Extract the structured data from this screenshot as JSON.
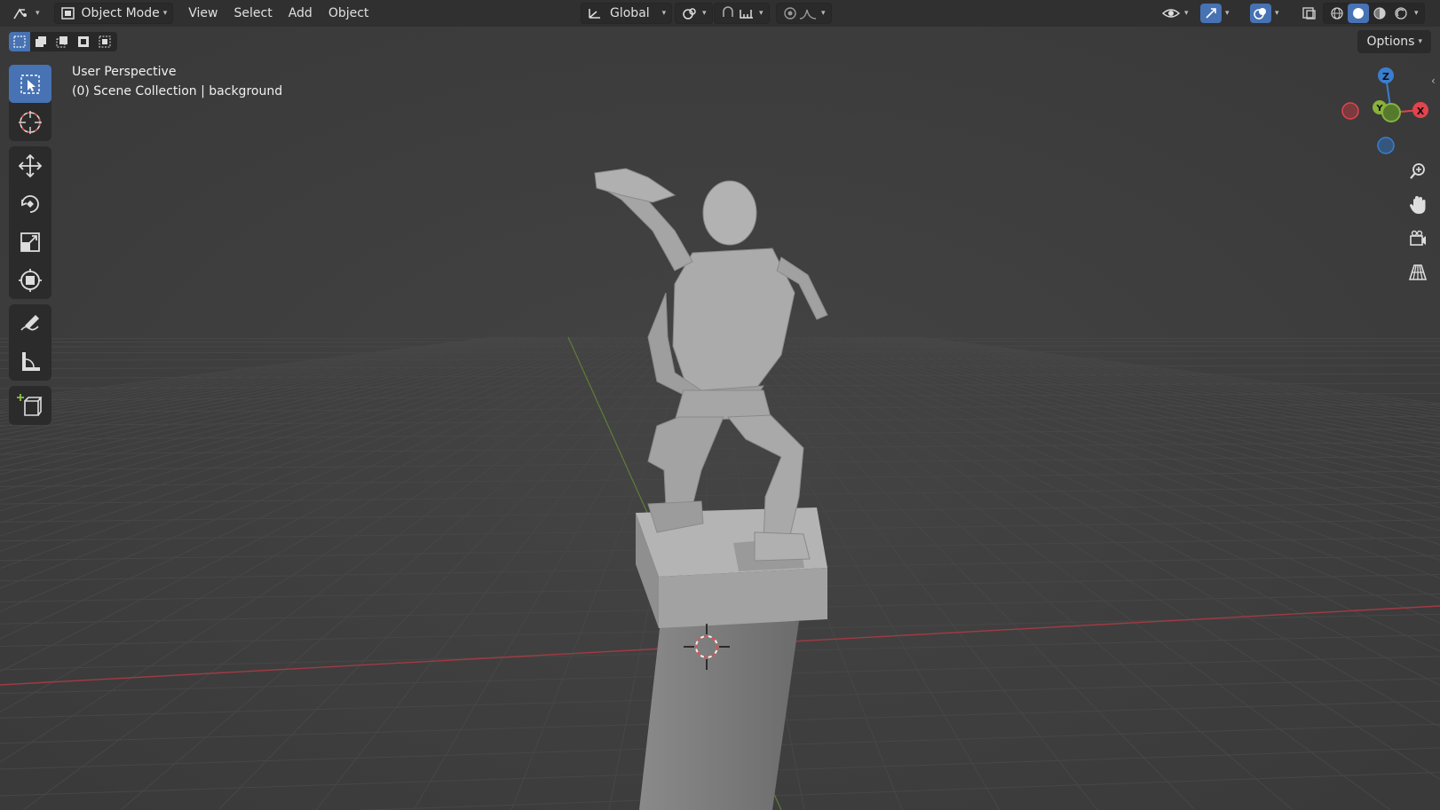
{
  "header": {
    "mode_label": "Object Mode",
    "menus": [
      "View",
      "Select",
      "Add",
      "Object"
    ],
    "transform_orientation": "Global"
  },
  "subheader": {
    "options_label": "Options"
  },
  "overlay": {
    "view_name": "User Perspective",
    "collection_info": "(0) Scene Collection | background"
  },
  "gizmo": {
    "z_label": "Z",
    "x_label": "X",
    "y_label": "Y"
  },
  "colors": {
    "active_tool": "#4772b3",
    "x_axis": "#e2444e",
    "y_axis": "#89b23a",
    "z_axis": "#3a7ed0",
    "grid_bg": "#3d3d3d"
  },
  "icons": {
    "toolbar": [
      "select-box-icon",
      "cursor-icon",
      "move-icon",
      "rotate-icon",
      "scale-icon",
      "transform-icon",
      "annotate-icon",
      "measure-icon",
      "add-cube-icon"
    ],
    "nav": [
      "zoom-icon",
      "hand-icon",
      "camera-icon",
      "grid-icon"
    ]
  }
}
